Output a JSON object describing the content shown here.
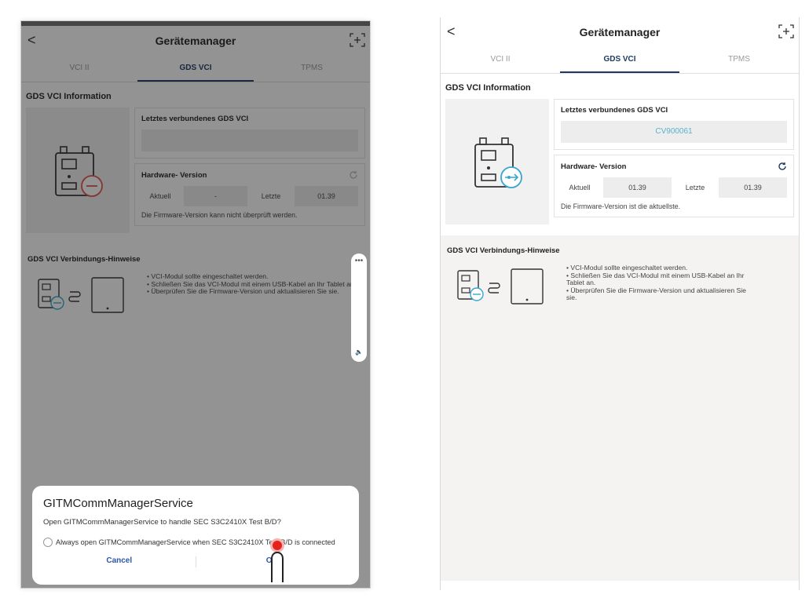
{
  "left": {
    "title": "Gerätemanager",
    "back_glyph": "<",
    "tabs": [
      "VCI II",
      "GDS VCI",
      "TPMS"
    ],
    "section_title": "GDS VCI Information",
    "last_connected_label": "Letztes verbundenes GDS VCI",
    "last_connected_value": "",
    "hardware_label": "Hardware- Version",
    "current_label": "Aktuell",
    "current_value": "-",
    "latest_label": "Letzte",
    "latest_value": "01.39",
    "fw_note": "Die Firmware-Version kann nicht überprüft werden.",
    "hints_title": "GDS VCI Verbindungs-Hinweise",
    "hints": [
      "• VCI-Modul sollte eingeschaltet werden.",
      "• Schließen Sie das VCI-Modul mit einem USB-Kabel an Ihr Tablet an.",
      "• Überprüfen Sie die Firmware-Version und aktualisieren Sie sie."
    ],
    "side_dots": "•••",
    "side_speaker": "🔈",
    "dialog": {
      "title": "GITMCommManagerService",
      "message": "Open GITMCommManagerService to handle SEC S3C2410X Test B/D?",
      "checkbox": "Always open GITMCommManagerService when SEC S3C2410X Test B/D is connected",
      "cancel": "Cancel",
      "ok": "OK"
    }
  },
  "right": {
    "title": "Gerätemanager",
    "back_glyph": "<",
    "tabs": [
      "VCI II",
      "GDS VCI",
      "TPMS"
    ],
    "section_title": "GDS VCI Information",
    "last_connected_label": "Letztes verbundenes GDS VCI",
    "last_connected_value": "CV900061",
    "hardware_label": "Hardware- Version",
    "current_label": "Aktuell",
    "current_value": "01.39",
    "latest_label": "Letzte",
    "latest_value": "01.39",
    "fw_note": "Die Firmware-Version ist die aktuellste.",
    "hints_title": "GDS VCI Verbindungs-Hinweise",
    "hints": [
      "• VCI-Modul sollte eingeschaltet werden.",
      "• Schließen Sie das VCI-Modul mit einem USB-Kabel an Ihr\nTablet an.",
      "• Überprüfen Sie die Firmware-Version und aktualisieren Sie\nsie."
    ]
  },
  "colors": {
    "accent": "#1e3a63",
    "serial": "#56b3cf",
    "error": "#e2504a",
    "usb": "#39a6cf",
    "dialog_button": "#2b57a6"
  },
  "icons": {
    "back": "chevron-left-icon",
    "scan": "scan-plus-icon",
    "refresh": "refresh-icon",
    "vci_disconnected": "vci-error-icon",
    "vci_connected": "vci-usb-icon",
    "cable": "usb-cable-icon",
    "tablet": "tablet-icon"
  }
}
